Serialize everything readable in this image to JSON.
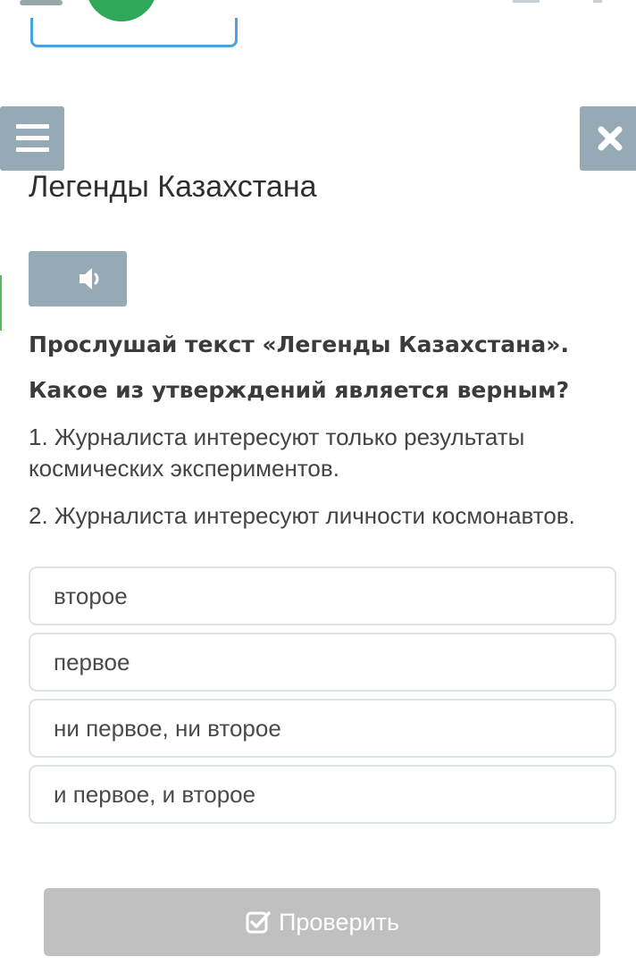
{
  "header": {
    "title": "Легенды Казахстана"
  },
  "toolbar": {
    "menu_icon": "hamburger-menu-icon",
    "close_icon": "close-x-icon",
    "audio_icon": "speaker-volume-icon"
  },
  "question": {
    "instruction_1": "Прослушай текст «Легенды Казахстана».",
    "instruction_2": "Какое из утверждений является верным?",
    "statement_1": "1. Журналиста интересуют только результаты космических экспериментов.",
    "statement_2": "2. Журналиста интересуют личности космонавтов."
  },
  "options": [
    {
      "label": "второе"
    },
    {
      "label": "первое"
    },
    {
      "label": "ни первое, ни второе"
    },
    {
      "label": "и первое, и второе"
    }
  ],
  "submit": {
    "label": "Проверить",
    "icon": "checkbox-check-icon"
  },
  "colors": {
    "button_bg": "#96aab5",
    "submit_disabled_bg": "#c0c0c0",
    "option_border": "#dbe3e6",
    "avatar_green": "#2fa85a",
    "field_blue": "#4aa3df"
  }
}
